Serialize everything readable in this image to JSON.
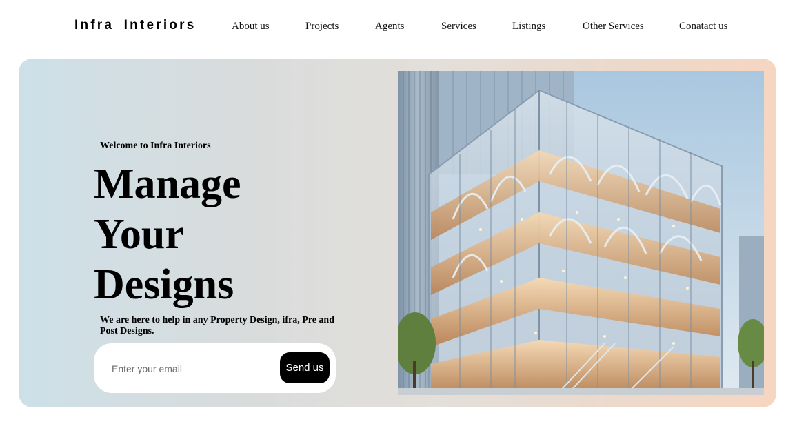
{
  "brand": {
    "name": "Infra  Interiors"
  },
  "nav": {
    "items": [
      {
        "label": "About us"
      },
      {
        "label": "Projects"
      },
      {
        "label": "Agents"
      },
      {
        "label": "Services"
      },
      {
        "label": "Listings"
      },
      {
        "label": "Other Services"
      },
      {
        "label": "Conatact us"
      }
    ]
  },
  "hero": {
    "welcome": "Welcome to Infra Interiors",
    "headline": [
      "Manage",
      "Your",
      "Designs"
    ],
    "subtext": "We are here to help in any Property Design, ifra, Pre and Post Designs.",
    "email": {
      "placeholder": "Enter your email",
      "value": ""
    },
    "send_label": "Send us",
    "image_subject": "glass-building-illustration"
  },
  "colors": {
    "gradient_start": "#cde0e8",
    "gradient_end": "#f6d6c1",
    "button": "#000000",
    "text": "#000000"
  }
}
